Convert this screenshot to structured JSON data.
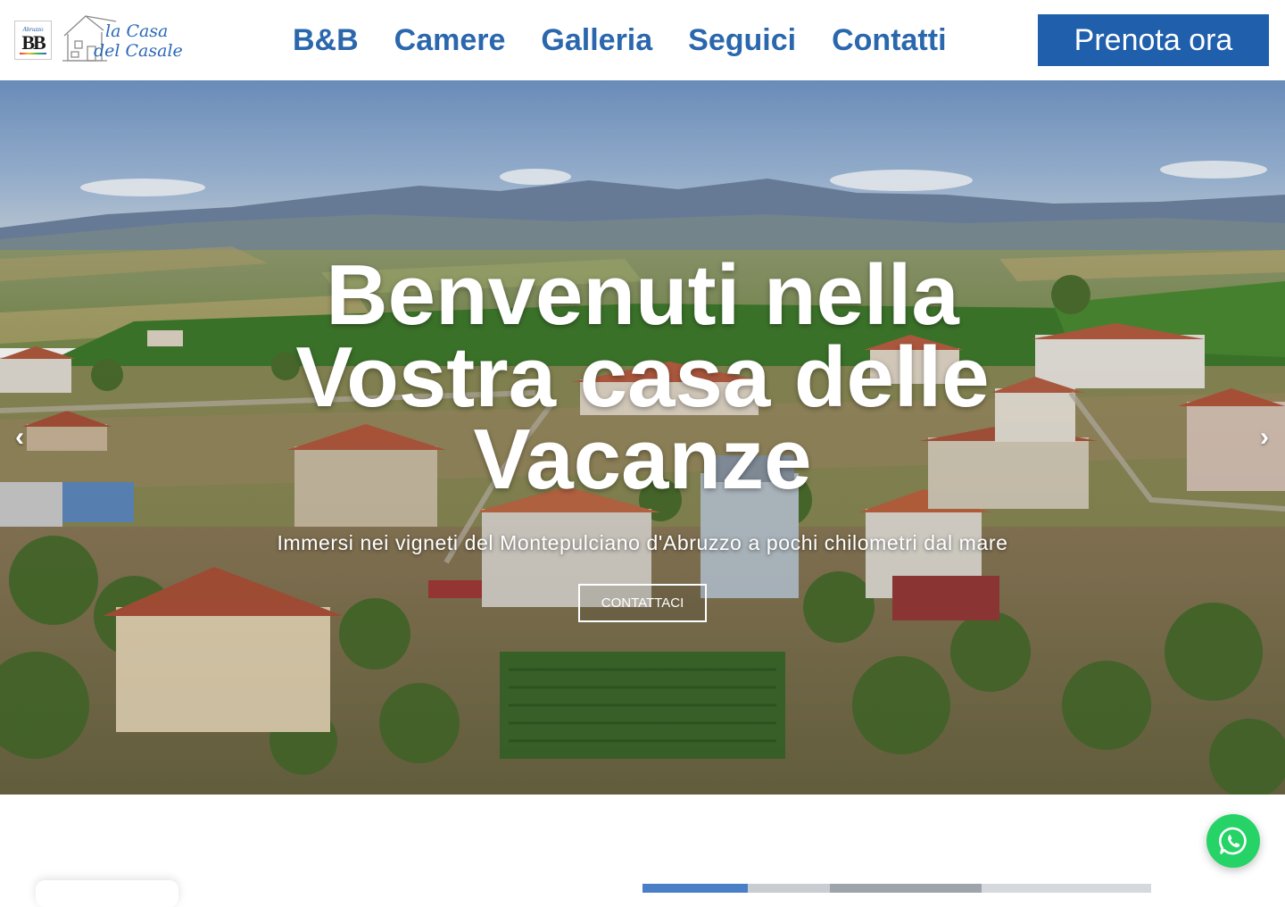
{
  "header": {
    "logo": {
      "badge_top": "Abruzzo",
      "badge_mark": "BB",
      "line1": "la Casa",
      "line2": "del Casale"
    },
    "nav": [
      {
        "label": "B&B"
      },
      {
        "label": "Camere"
      },
      {
        "label": "Galleria"
      },
      {
        "label": "Seguici"
      },
      {
        "label": "Contatti"
      }
    ],
    "book_label": "Prenota ora"
  },
  "hero": {
    "title": "Benvenuti nella Vostra casa delle Vacanze",
    "subtitle": "Immersi nei vigneti del Montepulciano d'Abruzzo a pochi chilometri dal mare",
    "cta_label": "CONTATTACI",
    "prev_arrow": "‹",
    "next_arrow": "›"
  },
  "colors": {
    "nav_text": "#2a67ad",
    "book_button": "#1f5fac",
    "whatsapp": "#25d366"
  },
  "icons": {
    "whatsapp": "whatsapp-icon",
    "prev": "chevron-left-icon",
    "next": "chevron-right-icon"
  }
}
